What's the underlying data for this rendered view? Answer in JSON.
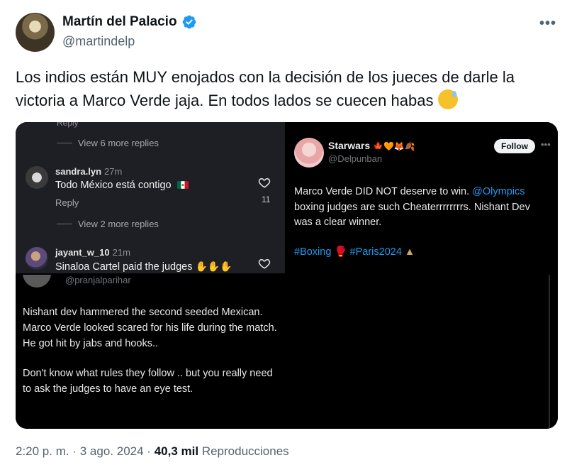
{
  "author": {
    "name": "Martín del Palacio",
    "handle": "@martindelp",
    "verified": true,
    "avatar_icon": "profile-photo"
  },
  "tweet": {
    "text": "Los indios están MUY enojados con la decisión de los jueces de darle la victoria a Marco Verde jaja. En todos lados se cuecen habas",
    "emoji": "grinning-face-with-sweat-emoji"
  },
  "media": {
    "instagram": {
      "reply_top": "Reply",
      "view_more_1": "View 6 more replies",
      "comment_1": {
        "user": "sandra.lyn",
        "time": "27m",
        "text": "Todo México está contigo",
        "reply": "Reply",
        "likes": "11",
        "flag": "mexico-flag-emoji"
      },
      "view_more_2": "View 2 more replies",
      "comment_2": {
        "user": "jayant_w_10",
        "time": "21m",
        "text": "Sinaloa Cartel paid the judges",
        "emoji": "clapping-hands-emoji x3"
      }
    },
    "starwars_post": {
      "name": "Starwars",
      "name_emojis": "🍁🧡🦊🍂",
      "handle": "@Delpunban",
      "follow_label": "Follow",
      "more": "•••",
      "text_pre": "Marco Verde DID NOT deserve to win. ",
      "mention": "@Olympics",
      "text_post": " boxing judges are such Cheaterrrrrrrrs. Nishant Dev was a clear winner.",
      "hashtag_1": "#Boxing",
      "hashtag_2": "#Paris2024"
    },
    "pranjal_post": {
      "handle": "@pranjalparihar",
      "line_1": "Nishant dev hammered the second seeded Mexican.",
      "line_2": "Marco Verde looked scared for his life during the match.  He got hit by jabs and hooks..",
      "line_3": "Don't know what rules they follow .. but you really need to ask the judges to have an eye test."
    }
  },
  "meta": {
    "time": "2:20 p. m.",
    "date": "3 ago. 2024",
    "separator": "·",
    "views": "40,3 mil",
    "views_label": "Reproducciones"
  },
  "colors": {
    "link": "#1d9bf0",
    "verified": "#1d9bf0",
    "muted": "#536471",
    "dark_panel": "#1e1f25"
  }
}
